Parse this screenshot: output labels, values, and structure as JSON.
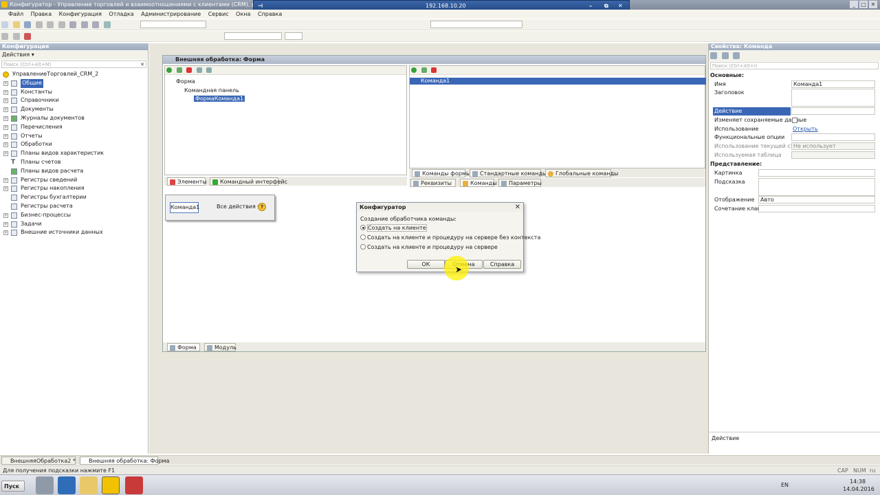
{
  "window": {
    "title": "Конфигуратор - Управление торговлей и взаимоотношениями с клиентами (CRM), редакц..."
  },
  "remote_bar": {
    "ip": "192.168.10.20"
  },
  "menu": [
    "Файл",
    "Правка",
    "Конфигурация",
    "Отладка",
    "Администрирование",
    "Сервис",
    "Окна",
    "Справка"
  ],
  "left_panel": {
    "title": "Конфигурация",
    "actions_label": "Действия ▾",
    "search_placeholder": "Поиск (Ctrl+Alt+M)",
    "root": "УправлениеТорговлей_CRM_2",
    "items": [
      "Общие",
      "Константы",
      "Справочники",
      "Документы",
      "Журналы документов",
      "Перечисления",
      "Отчеты",
      "Обработки",
      "Планы видов характеристик",
      "Планы счетов",
      "Планы видов расчета",
      "Регистры сведений",
      "Регистры накопления",
      "Регистры бухгалтерии",
      "Регистры расчета",
      "Бизнес-процессы",
      "Задачи",
      "Внешние источники данных"
    ]
  },
  "form_window": {
    "title": "Внешняя обработка: Форма",
    "tree": {
      "root": "Форма",
      "child": "Командная панель",
      "leaf": "ФормаКоманда1"
    },
    "left_tabs": [
      "Элементы",
      "Командный интерфейс"
    ],
    "commands_list": [
      "Команда1"
    ],
    "cmd_tabs": [
      "Команды формы",
      "Стандартные команды",
      "Глобальные команды"
    ],
    "right_tabs": [
      "Реквизиты",
      "Команды",
      "Параметры"
    ],
    "preview": {
      "button": "Команда1",
      "all_actions": "Все действия ▾",
      "help": "?"
    },
    "bottom_tabs": [
      "Форма",
      "Модуль"
    ]
  },
  "dialog": {
    "title": "Конфигуратор",
    "prompt": "Создание обработчика команды:",
    "options": [
      "Создать на клиенте",
      "Создать на клиенте и процедуру на сервере без контекста",
      "Создать на клиенте и процедуру на сервере"
    ],
    "selected_index": 0,
    "buttons": {
      "ok": "ОК",
      "cancel": "Отмена",
      "help": "Справка"
    }
  },
  "properties": {
    "title": "Свойства: Команда",
    "search_placeholder": "Поиск (Ctrl+Alt+I)",
    "section_main": "Основные:",
    "name_label": "Имя",
    "name_value": "Команда1",
    "caption_label": "Заголовок",
    "action_label": "Действие",
    "modifies_label": "Изменяет сохраняемые данные",
    "usage_label": "Использование",
    "usage_value": "Открыть",
    "func_options_label": "Функциональные опции",
    "current_row_label": "Использование текущей строки",
    "current_row_value": "Не использует",
    "used_table_label": "Используемая таблица",
    "section_view": "Представление:",
    "picture_label": "Картинка",
    "tooltip_label": "Подсказка",
    "display_label": "Отображение",
    "display_value": "Авто",
    "shortcut_label": "Сочетание клавиш",
    "bottom_label": "Действие"
  },
  "doc_tabs": [
    "ВнешняяОбработка2 *",
    "Внешняя обработка: Форма"
  ],
  "status": {
    "hint": "Для получения подсказки нажмите F1",
    "cap": "CAP",
    "num": "NUM",
    "lang": "ru"
  },
  "taskbar": {
    "start": "Пуск",
    "lang": "EN",
    "time": "14:38",
    "date": "14.04.2016"
  }
}
